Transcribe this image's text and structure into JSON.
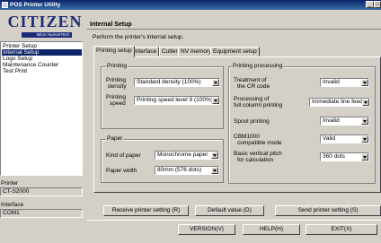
{
  "window": {
    "title": "POS Printer Utility"
  },
  "logo": {
    "brand": "CITIZEN",
    "tagline": "Micro HumanTech"
  },
  "nav": {
    "items": [
      {
        "label": "Printer Setup"
      },
      {
        "label": "Internal Setup",
        "selected": true
      },
      {
        "label": "Logo Setup"
      },
      {
        "label": "Maintenance Counter"
      },
      {
        "label": "Test Print"
      }
    ]
  },
  "status": {
    "printer_label": "Printer",
    "printer_value": "CT-S2000",
    "interface_label": "Interface",
    "interface_value": "COM1"
  },
  "main": {
    "title": "Internal Setup",
    "description": "Perform the printer's internal setup."
  },
  "tabs": [
    {
      "label": "Printing setup",
      "active": true
    },
    {
      "label": "Interface"
    },
    {
      "label": "Cutter"
    },
    {
      "label": "NV memory"
    },
    {
      "label": "Equipment setup"
    }
  ],
  "printing": {
    "title": "Printing",
    "density_label1": "Printing",
    "density_label2": "density",
    "density_value": "Standard density (100%)",
    "speed_label1": "Printing",
    "speed_label2": "speed",
    "speed_value": "Printing speed level 9 (100%)"
  },
  "paper": {
    "title": "Paper",
    "kind_label": "Kind of paper",
    "kind_value": "Monochrome paper",
    "width_label": "Paper width",
    "width_value": "80mm (576 dots)"
  },
  "processing": {
    "title": "Printing processing",
    "cr_label1": "Treatment of",
    "cr_label2": "the CR code",
    "cr_value": "Invalid",
    "fullcol_label1": "Processing of",
    "fullcol_label2": "full column printing",
    "fullcol_value": "Immediate line feed",
    "spool_label": "Spool printing",
    "spool_value": "Invalid",
    "cbm_label1": "CBM1000",
    "cbm_label2": "compatible mode",
    "cbm_value": "Valid",
    "pitch_label1": "Basic vertical pitch",
    "pitch_label2": "for calculation",
    "pitch_value": "360 dots"
  },
  "actions": {
    "receive": "Receive printer setting (R)",
    "default": "Default value (D)",
    "send": "Send printer setting (S)"
  },
  "footer": {
    "version": "VERSION(V)",
    "help": "HELP(H)",
    "exit": "EXIT(X)"
  }
}
